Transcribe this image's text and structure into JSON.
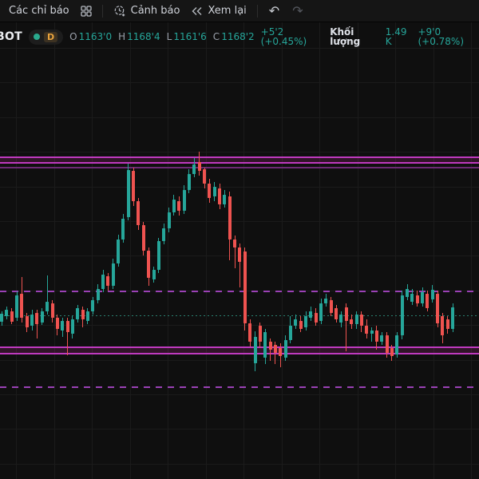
{
  "toolbar": {
    "indicators_button": "Các chỉ báo",
    "alerts_button": "Cảnh báo",
    "replay_button": "Xem lại",
    "icons": {
      "indicators_grid": "four-squares",
      "alert_clock": "clock-plus",
      "replay": "double-chevron-left",
      "undo": "↶",
      "redo": "↷"
    }
  },
  "legend": {
    "symbol": "BOT",
    "timeframe": "D",
    "status_color": "#2aa98d",
    "open_label": "O",
    "open": "1163'0",
    "high_label": "H",
    "high": "1168'4",
    "low_label": "L",
    "low": "1161'6",
    "close_label": "C",
    "close": "1168'2",
    "change": "+5'2 (+0.45%)",
    "volume_label": "Khối lượng",
    "volume": "1.49 K",
    "volume_change": "+9'0 (+0.78%)"
  },
  "chart_data": {
    "type": "candlestick",
    "title": "",
    "ylim": [
      1111.75,
      1254.75
    ],
    "x_start": 2,
    "x_step": 6.35,
    "candle_width": 4,
    "grid": {
      "v_start": 20,
      "v_step": 47.5,
      "v_count": 13,
      "h_start": 32,
      "h_step": 43.4,
      "h_count": 13
    },
    "colors": {
      "up": "#26a69a",
      "down": "#ef5350",
      "grid": "#1b1b1b",
      "band_line": "#bf3abf",
      "band_fill": "rgba(170,40,130,0.22)",
      "band_line_dim": "#6e2a75",
      "dashed": "#9a41b5",
      "dotted": "#2a7f6f"
    },
    "levels": [
      {
        "kind": "band",
        "from": 1212.5,
        "to": 1210.75
      },
      {
        "kind": "dimline",
        "price": 1209.25
      },
      {
        "kind": "dashed",
        "price": 1170.5
      },
      {
        "kind": "dotted",
        "price": 1163.0
      },
      {
        "kind": "band",
        "from": 1153.0,
        "to": 1151.0
      },
      {
        "kind": "dashed",
        "price": 1140.5
      }
    ],
    "candles": [
      [
        1161,
        1164.25,
        1159.75,
        1163.5
      ],
      [
        1162.75,
        1165.75,
        1161.75,
        1164.75
      ],
      [
        1164.25,
        1165.25,
        1160.25,
        1161
      ],
      [
        1162.25,
        1170.5,
        1161.25,
        1169.25
      ],
      [
        1169.75,
        1175,
        1160.75,
        1162.25
      ],
      [
        1162.75,
        1163.75,
        1157.75,
        1159.25
      ],
      [
        1159.75,
        1164.75,
        1158.25,
        1163.25
      ],
      [
        1163.75,
        1164.75,
        1155.75,
        1160.25
      ],
      [
        1160.75,
        1165.25,
        1160,
        1164.25
      ],
      [
        1164.25,
        1175.5,
        1163.25,
        1167.25
      ],
      [
        1166.75,
        1167.75,
        1160.75,
        1162.25
      ],
      [
        1162.25,
        1163.25,
        1156.75,
        1158.75
      ],
      [
        1158.25,
        1162.25,
        1156.25,
        1161.25
      ],
      [
        1161.25,
        1162.25,
        1150.5,
        1157.75
      ],
      [
        1157.25,
        1162.75,
        1155.75,
        1161.75
      ],
      [
        1161.75,
        1166.25,
        1160.75,
        1165.25
      ],
      [
        1164.75,
        1165.75,
        1159.25,
        1161.75
      ],
      [
        1161.25,
        1165.25,
        1160.25,
        1164.25
      ],
      [
        1164.25,
        1168.75,
        1163.25,
        1167.75
      ],
      [
        1167.75,
        1172.75,
        1166.75,
        1171.25
      ],
      [
        1171.25,
        1177.25,
        1170.25,
        1175.75
      ],
      [
        1175.25,
        1176.25,
        1170.75,
        1172.25
      ],
      [
        1172.25,
        1180.75,
        1171.25,
        1179.25
      ],
      [
        1179.25,
        1188.25,
        1178.25,
        1186.75
      ],
      [
        1186.75,
        1194.75,
        1185.75,
        1193.25
      ],
      [
        1193.75,
        1210.5,
        1192.75,
        1208.5
      ],
      [
        1208.25,
        1209.25,
        1197.25,
        1198.75
      ],
      [
        1198.75,
        1199.75,
        1189.75,
        1191.25
      ],
      [
        1191.25,
        1192.25,
        1181.75,
        1183.25
      ],
      [
        1183.25,
        1184.25,
        1172.25,
        1174.75
      ],
      [
        1174.25,
        1178.25,
        1173.25,
        1177.25
      ],
      [
        1177.25,
        1187.25,
        1176.25,
        1186.25
      ],
      [
        1186.25,
        1191.75,
        1185.25,
        1190.25
      ],
      [
        1190.25,
        1196.75,
        1189,
        1195.25
      ],
      [
        1195.25,
        1200.75,
        1194.25,
        1199.25
      ],
      [
        1198.75,
        1200.25,
        1194.25,
        1195.75
      ],
      [
        1195.75,
        1203.75,
        1194.75,
        1202.25
      ],
      [
        1202.25,
        1208.75,
        1201.25,
        1207.25
      ],
      [
        1207.25,
        1212.25,
        1206.25,
        1210.25
      ],
      [
        1211,
        1214.25,
        1206.75,
        1208.25
      ],
      [
        1208.75,
        1209.25,
        1202.75,
        1204.25
      ],
      [
        1204.25,
        1205.75,
        1198.25,
        1199.75
      ],
      [
        1200.25,
        1204.75,
        1198.75,
        1203.25
      ],
      [
        1202.75,
        1204.25,
        1196.25,
        1197.75
      ],
      [
        1197.75,
        1202.25,
        1196.75,
        1200.75
      ],
      [
        1200.25,
        1201.75,
        1180.25,
        1186.75
      ],
      [
        1186.75,
        1188,
        1177.75,
        1184.25
      ],
      [
        1184.25,
        1185.5,
        1171.75,
        1179.75
      ],
      [
        1183,
        1184.25,
        1158.25,
        1160.5
      ],
      [
        1160.5,
        1161.75,
        1153.25,
        1154.75
      ],
      [
        1148,
        1158,
        1145.5,
        1156.25
      ],
      [
        1159.75,
        1160.75,
        1152.75,
        1154.75
      ],
      [
        1149.75,
        1158.75,
        1147.75,
        1157.75
      ],
      [
        1154.75,
        1155.75,
        1148.75,
        1152.25
      ],
      [
        1153.75,
        1154.75,
        1147.75,
        1151.25
      ],
      [
        1152.75,
        1154.25,
        1146.75,
        1150.25
      ],
      [
        1149.75,
        1156.75,
        1148.75,
        1155.25
      ],
      [
        1155.25,
        1162.75,
        1154.25,
        1159.75
      ],
      [
        1159.75,
        1163.25,
        1158.75,
        1161.75
      ],
      [
        1161.25,
        1162.75,
        1157.75,
        1158.75
      ],
      [
        1159.25,
        1164.25,
        1158.25,
        1162.75
      ],
      [
        1162.25,
        1165.75,
        1161.25,
        1164.25
      ],
      [
        1163.75,
        1165.25,
        1159.75,
        1160.75
      ],
      [
        1161.25,
        1168.25,
        1160.25,
        1166.75
      ],
      [
        1166.75,
        1169.75,
        1165.75,
        1168.25
      ],
      [
        1167.75,
        1168.75,
        1162.75,
        1163.75
      ],
      [
        1165.25,
        1166.25,
        1160.75,
        1161.75
      ],
      [
        1160.75,
        1164.25,
        1159.25,
        1163.25
      ],
      [
        1165.5,
        1166.75,
        1151.75,
        1161.25
      ],
      [
        1161.75,
        1163.25,
        1158.75,
        1160.25
      ],
      [
        1160.25,
        1164.25,
        1158.75,
        1163.25
      ],
      [
        1163.25,
        1164.25,
        1157.75,
        1159.75
      ],
      [
        1159.75,
        1161.75,
        1155.75,
        1157.25
      ],
      [
        1157.25,
        1159.25,
        1154.75,
        1158.25
      ],
      [
        1158.25,
        1159.75,
        1152.25,
        1154.75
      ],
      [
        1154.75,
        1157.75,
        1153.75,
        1156.75
      ],
      [
        1156.75,
        1157.75,
        1149.75,
        1151.25
      ],
      [
        1152.75,
        1153.75,
        1148.75,
        1150.25
      ],
      [
        1150.75,
        1157.75,
        1149.75,
        1156.75
      ],
      [
        1156.75,
        1170.75,
        1155.5,
        1169.25
      ],
      [
        1168.75,
        1172.75,
        1167.75,
        1171.25
      ],
      [
        1167.25,
        1171.25,
        1166.25,
        1169.75
      ],
      [
        1169.25,
        1170.75,
        1165.75,
        1166.75
      ],
      [
        1166.75,
        1171.75,
        1165.75,
        1170.25
      ],
      [
        1169.75,
        1170.75,
        1164.25,
        1165.25
      ],
      [
        1168,
        1172.5,
        1167,
        1171
      ],
      [
        1169.75,
        1170.75,
        1159.25,
        1160.5
      ],
      [
        1162.75,
        1163.75,
        1154.25,
        1156.75
      ],
      [
        1161.75,
        1162.75,
        1157.25,
        1158.75
      ],
      [
        1158.75,
        1166.75,
        1157.75,
        1165.5
      ]
    ]
  }
}
